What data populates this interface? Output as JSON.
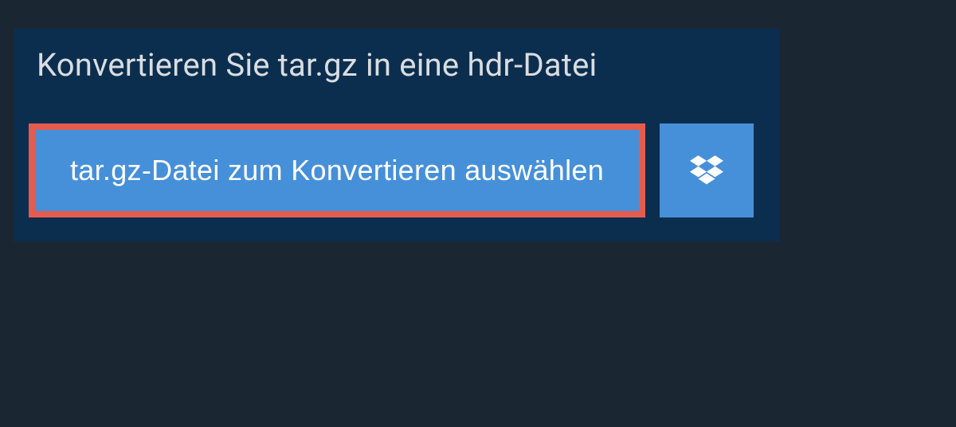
{
  "header": {
    "title": "Konvertieren Sie tar.gz in eine hdr-Datei"
  },
  "buttons": {
    "select_file_label": "tar.gz-Datei zum Konvertieren auswählen"
  }
}
